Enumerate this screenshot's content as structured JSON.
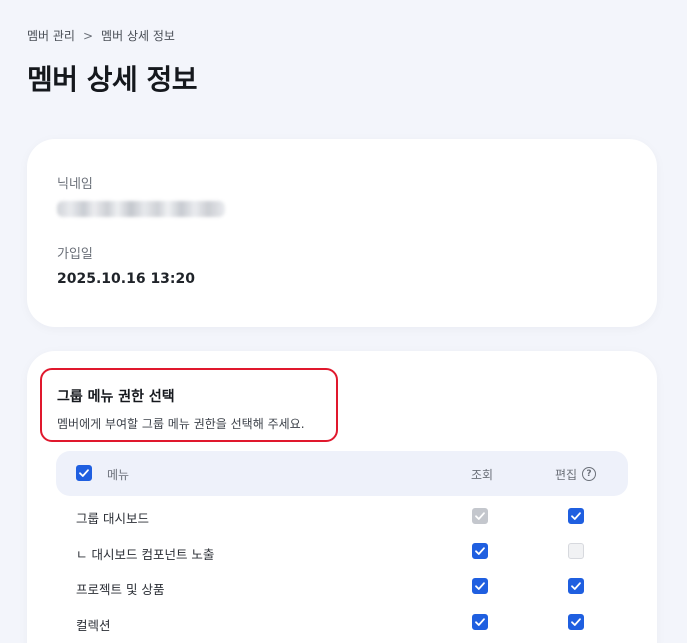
{
  "breadcrumb": {
    "parent": "멤버 관리",
    "separator": ">",
    "current": "멤버 상세 정보"
  },
  "page_title": "멤버 상세 정보",
  "info": {
    "nickname_label": "닉네임",
    "nickname_value": "",
    "joined_label": "가입일",
    "joined_value": "2025.10.16 13:20"
  },
  "permissions": {
    "title": "그룹 메뉴 권한 선택",
    "description": "멤버에게 부여할 그룹 메뉴 권한을 선택해 주세요.",
    "header": {
      "menu": "메뉴",
      "view": "조회",
      "edit": "편집",
      "select_all_checked": true
    },
    "rows": [
      {
        "label": "그룹 대시보드",
        "view": "checked-disabled",
        "edit": "checked"
      },
      {
        "label": "ㄴ 대시보드 컴포넌트 노출",
        "view": "checked",
        "edit": "unchecked-disabled"
      },
      {
        "label": "프로젝트 및 상품",
        "view": "checked",
        "edit": "checked"
      },
      {
        "label": "컬렉션",
        "view": "checked",
        "edit": "checked"
      }
    ]
  },
  "colors": {
    "accent": "#1f5fe0",
    "highlight": "#e0182d",
    "background": "#f3f5fb"
  }
}
